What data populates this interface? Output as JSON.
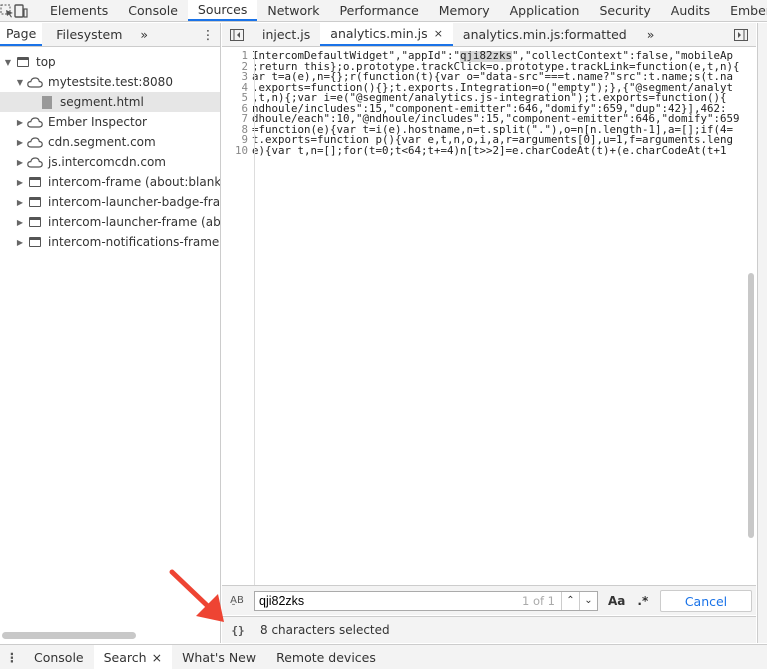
{
  "main_tabs": [
    "Elements",
    "Console",
    "Sources",
    "Network",
    "Performance",
    "Memory",
    "Application",
    "Security",
    "Audits",
    "Ember"
  ],
  "navigator": {
    "tabs": [
      "Page",
      "Filesystem"
    ],
    "more": "»",
    "menu": "⋮",
    "tree": [
      {
        "label": "top",
        "indent": 0,
        "icon": "frame",
        "expanded": true
      },
      {
        "label": "mytestsite.test:8080",
        "indent": 1,
        "icon": "cloud",
        "expanded": true
      },
      {
        "label": "segment.html",
        "indent": 2,
        "icon": "file",
        "selected": true
      },
      {
        "label": "Ember Inspector",
        "indent": 1,
        "icon": "cloud",
        "expanded": false
      },
      {
        "label": "cdn.segment.com",
        "indent": 1,
        "icon": "cloud",
        "expanded": false
      },
      {
        "label": "js.intercomcdn.com",
        "indent": 1,
        "icon": "cloud",
        "expanded": false
      },
      {
        "label": "intercom-frame (about:blank)",
        "indent": 1,
        "icon": "frame",
        "expanded": false
      },
      {
        "label": "intercom-launcher-badge-frame",
        "indent": 1,
        "icon": "frame",
        "expanded": false
      },
      {
        "label": "intercom-launcher-frame (about:b",
        "indent": 1,
        "icon": "frame",
        "expanded": false
      },
      {
        "label": "intercom-notifications-frame (abo",
        "indent": 1,
        "icon": "frame",
        "expanded": false
      }
    ]
  },
  "editor": {
    "tabs": [
      {
        "label": "inject.js",
        "active": false,
        "closable": false
      },
      {
        "label": "analytics.min.js",
        "active": true,
        "closable": true
      },
      {
        "label": "analytics.min.js:formatted",
        "active": false,
        "closable": false
      }
    ],
    "more": "»",
    "close_glyph": "×",
    "lines": [
      {
        "num": "1",
        "pre": "IntercomDefaultWidget\",\"appId\":\"",
        "hl": "qji82zks",
        "post": "\",\"collectContext\":false,\"mobileAp"
      },
      {
        "num": "2",
        "pre": ";return this};o.prototype.trackClick=o.prototype.trackLink=function(e,t,n){",
        "hl": "",
        "post": ""
      },
      {
        "num": "3",
        "pre": "ar t=a(e),n={};r(function(t){var o=\"data-src\"===t.name?\"src\":t.name;s(t.na",
        "hl": "",
        "post": ""
      },
      {
        "num": "4",
        "pre": ".exports=function(){};t.exports.Integration=o(\"empty\");},{\"@segment/analyt",
        "hl": "",
        "post": ""
      },
      {
        "num": "5",
        "pre": ",t,n){;var i=e(\"@segment/analytics.js-integration\");t.exports=function(){",
        "hl": "",
        "post": ""
      },
      {
        "num": "6",
        "pre": "ndhoule/includes\":15,\"component-emitter\":646,\"domify\":659,\"dup\":42}],462:",
        "hl": "",
        "post": ""
      },
      {
        "num": "7",
        "pre": "dhoule/each\":10,\"@ndhoule/includes\":15,\"component-emitter\":646,\"domify\":659",
        "hl": "",
        "post": ""
      },
      {
        "num": "8",
        "pre": "=function(e){var t=i(e).hostname,n=t.split(\".\"),o=n[n.length-1],a=[];if(4=",
        "hl": "",
        "post": ""
      },
      {
        "num": "9",
        "pre": "t.exports=function p(){var e,t,n,o,i,a,r=arguments[0],u=1,f=arguments.leng",
        "hl": "",
        "post": ""
      },
      {
        "num": "10",
        "pre": "e){var t,n=[];for(t=0;t<64;t+=4)n[t>>2]=e.charCodeAt(t)+(e.charCodeAt(t+1",
        "hl": "",
        "post": ""
      }
    ]
  },
  "search": {
    "case_label": "A̱B",
    "query": "qji82zks",
    "count": "1 of 1",
    "prev": "⌃",
    "next": "⌄",
    "match_case": "Aa",
    "regex": ".*",
    "cancel": "Cancel"
  },
  "status": {
    "pretty_print": "{}",
    "text": "8 characters selected"
  },
  "drawer": {
    "menu": "⋮",
    "tabs": [
      {
        "label": "Console",
        "active": false,
        "closable": false
      },
      {
        "label": "Search",
        "active": true,
        "closable": true
      },
      {
        "label": "What's New",
        "active": false,
        "closable": false
      },
      {
        "label": "Remote devices",
        "active": false,
        "closable": false
      }
    ]
  },
  "colors": {
    "accent": "#1a73e8",
    "arrow": "#ee4433"
  }
}
